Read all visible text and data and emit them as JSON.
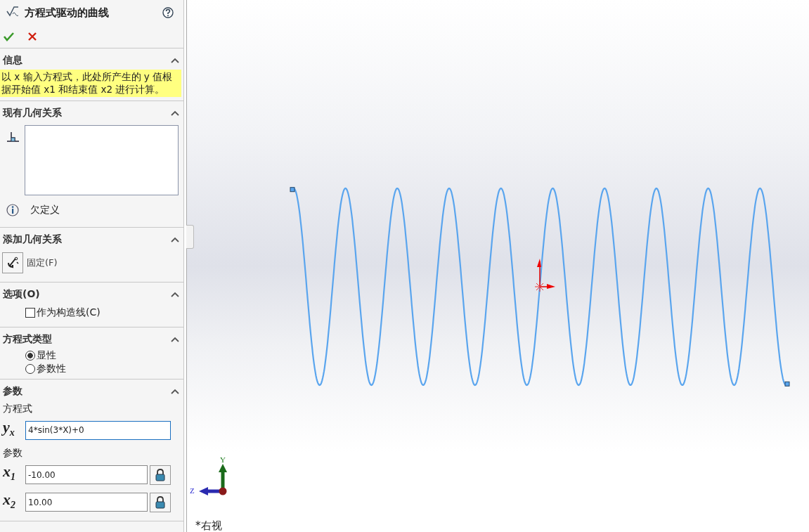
{
  "panel": {
    "title": "方程式驱动的曲线"
  },
  "sections": [
    {
      "kind": "info",
      "title": "信息",
      "expanded": true,
      "message": "以 x 输入方程式，此处所产生的 y 值根据开始值 x1 和结束值 x2 进行计算。"
    },
    {
      "kind": "relations",
      "title": "现有几何关系",
      "expanded": true,
      "status": "欠定义"
    },
    {
      "kind": "add_relations",
      "title": "添加几何关系",
      "expanded": true,
      "items": [
        {
          "label": "固定(F)"
        }
      ]
    },
    {
      "kind": "options",
      "title": "选项(O)",
      "expanded": true,
      "items": [
        {
          "label": "作为构造线(C)",
          "checked": false
        }
      ]
    },
    {
      "kind": "equation_type",
      "title": "方程式类型",
      "expanded": true,
      "options": [
        {
          "label": "显性",
          "selected": true
        },
        {
          "label": "参数性",
          "selected": false
        }
      ]
    },
    {
      "kind": "parameters",
      "title": "参数",
      "expanded": true,
      "equation_label": "方程式",
      "equation_symbol": "y$_{x}$",
      "equation": "4*sin(3*X)+0",
      "params_label": "参数",
      "params": [
        {
          "symbol": "x$_{1}$",
          "value": "-10.00"
        },
        {
          "symbol": "x$_{2}$",
          "value": "10.00"
        }
      ]
    }
  ],
  "viewport": {
    "triad": {
      "y_label": "Y",
      "z_label": "Z"
    },
    "view_name": "*右视"
  }
}
